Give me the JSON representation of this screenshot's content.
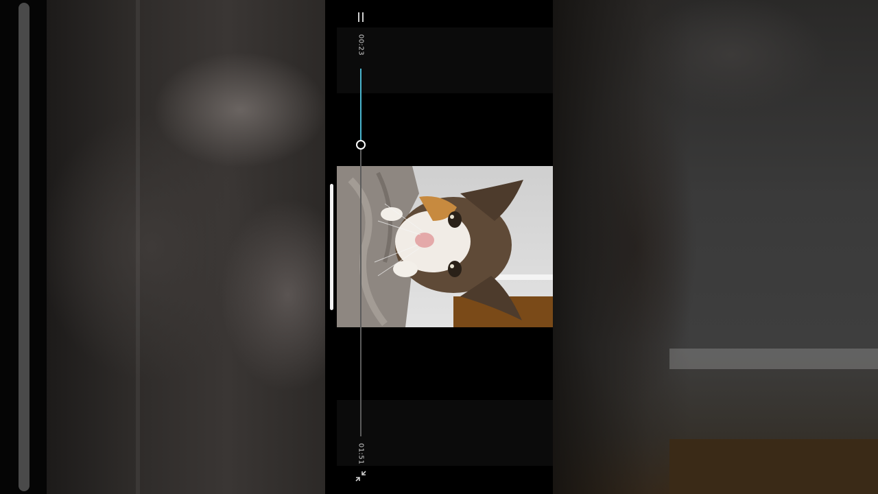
{
  "player": {
    "current_time": "00:23",
    "duration": "01:51",
    "progress_fraction": 0.207
  },
  "icons": {
    "menu": "pause-icon",
    "fullscreen": "exit-fullscreen-icon",
    "drag": "drag-handle"
  },
  "colors": {
    "seek_fill": "#4bb7d0",
    "background": "#000000"
  }
}
